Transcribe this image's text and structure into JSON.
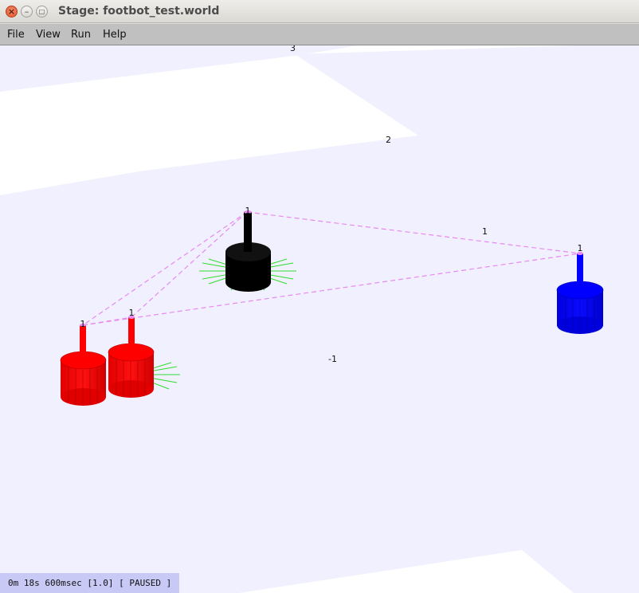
{
  "window": {
    "title": "Stage: footbot_test.world",
    "close_glyph": "×",
    "min_glyph": "–",
    "max_glyph": "□"
  },
  "menu": {
    "items": [
      "File",
      "View",
      "Run",
      "Help"
    ]
  },
  "scene": {
    "axis_labels": [
      "3",
      "2",
      "1",
      "-1"
    ],
    "robot_labels": [
      "1",
      "1",
      "1",
      "1"
    ],
    "floor_colors": {
      "light": "#ffffff",
      "tint": "#f0f0fe"
    },
    "robot_colors": {
      "red": "#ff0000",
      "black": "#000000",
      "blue": "#0000ff"
    },
    "laser_color": "#2fdc2f",
    "link_color": "#e889f0"
  },
  "status": {
    "text": "0m 18s 600msec [1.0] [ PAUSED ]"
  }
}
